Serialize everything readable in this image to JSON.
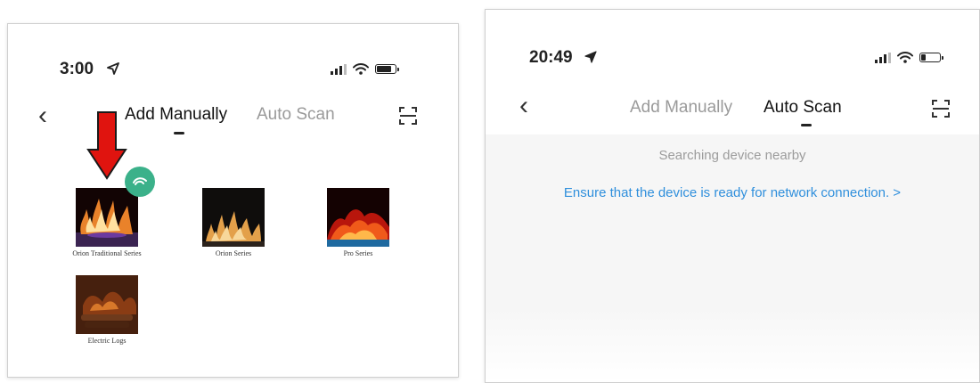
{
  "colors": {
    "accent_red": "#e0140f",
    "link_blue": "#2f8fdc",
    "badge_green": "#3bb18a"
  },
  "left_screen": {
    "status": {
      "time": "3:00",
      "location_icon": "location-arrow-icon",
      "signal_icon": "signal-bars-icon",
      "wifi_icon": "wifi-icon",
      "battery_icon": "battery-icon",
      "battery_level": 0.85
    },
    "nav": {
      "back_icon": "back-chevron-icon",
      "tabs": [
        {
          "label": "Add Manually",
          "active": true
        },
        {
          "label": "Auto Scan",
          "active": false
        }
      ],
      "scan_icon": "scan-frame-icon"
    },
    "annotation_icon": "red-down-arrow-icon",
    "devices": [
      {
        "label": "Orion Traditional Series",
        "icon": "fireplace-flame-thumbnail",
        "badge_icon": "connect-badge-icon"
      },
      {
        "label": "Orion Series",
        "icon": "fireplace-flame-thumbnail"
      },
      {
        "label": "Pro Series",
        "icon": "fireplace-flame-thumbnail"
      },
      {
        "label": "Electric Logs",
        "icon": "electric-logs-thumbnail"
      }
    ]
  },
  "right_screen": {
    "status": {
      "time": "20:49",
      "location_icon": "location-arrow-icon",
      "signal_icon": "signal-bars-icon",
      "wifi_icon": "wifi-icon",
      "battery_icon": "battery-icon",
      "battery_level": 0.25
    },
    "nav": {
      "back_icon": "back-chevron-icon",
      "tabs": [
        {
          "label": "Add Manually",
          "active": false
        },
        {
          "label": "Auto Scan",
          "active": true
        }
      ],
      "scan_icon": "scan-frame-icon"
    },
    "searching_text": "Searching device nearby",
    "ready_link": "Ensure that the device is ready for network connection. >"
  }
}
